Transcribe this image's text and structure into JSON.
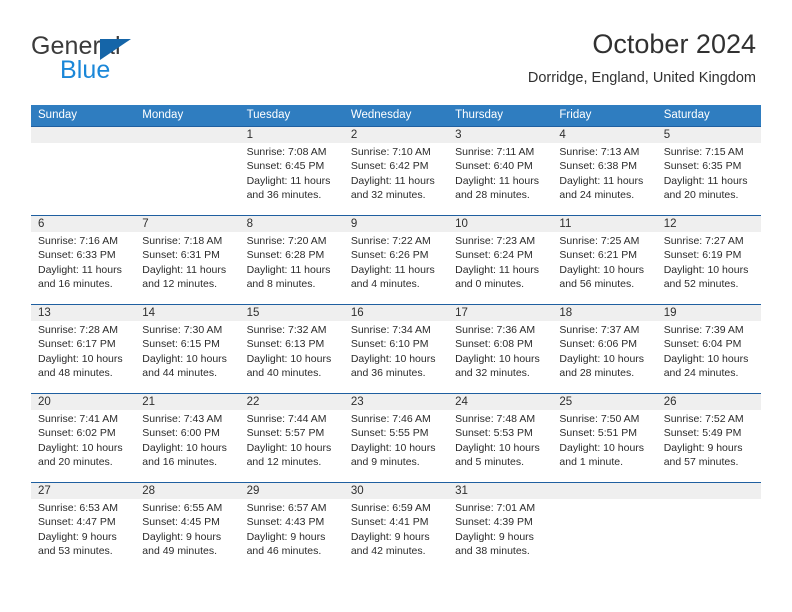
{
  "brand": {
    "line1": "General",
    "line2": "Blue",
    "triangle_color": "#1565a8",
    "line2_color": "#1a87d8"
  },
  "header": {
    "title": "October 2024",
    "subtitle": "Dorridge, England, United Kingdom"
  },
  "theme": {
    "header_row_bg": "#2f7dc0",
    "week_rule": "#1f5fa0",
    "daynum_band": "#efefef"
  },
  "weekdays": [
    "Sunday",
    "Monday",
    "Tuesday",
    "Wednesday",
    "Thursday",
    "Friday",
    "Saturday"
  ],
  "weeks": [
    [
      {
        "day": "",
        "sunrise": "",
        "sunset": "",
        "daylight_l1": "",
        "daylight_l2": ""
      },
      {
        "day": "",
        "sunrise": "",
        "sunset": "",
        "daylight_l1": "",
        "daylight_l2": ""
      },
      {
        "day": "1",
        "sunrise": "Sunrise: 7:08 AM",
        "sunset": "Sunset: 6:45 PM",
        "daylight_l1": "Daylight: 11 hours",
        "daylight_l2": "and 36 minutes."
      },
      {
        "day": "2",
        "sunrise": "Sunrise: 7:10 AM",
        "sunset": "Sunset: 6:42 PM",
        "daylight_l1": "Daylight: 11 hours",
        "daylight_l2": "and 32 minutes."
      },
      {
        "day": "3",
        "sunrise": "Sunrise: 7:11 AM",
        "sunset": "Sunset: 6:40 PM",
        "daylight_l1": "Daylight: 11 hours",
        "daylight_l2": "and 28 minutes."
      },
      {
        "day": "4",
        "sunrise": "Sunrise: 7:13 AM",
        "sunset": "Sunset: 6:38 PM",
        "daylight_l1": "Daylight: 11 hours",
        "daylight_l2": "and 24 minutes."
      },
      {
        "day": "5",
        "sunrise": "Sunrise: 7:15 AM",
        "sunset": "Sunset: 6:35 PM",
        "daylight_l1": "Daylight: 11 hours",
        "daylight_l2": "and 20 minutes."
      }
    ],
    [
      {
        "day": "6",
        "sunrise": "Sunrise: 7:16 AM",
        "sunset": "Sunset: 6:33 PM",
        "daylight_l1": "Daylight: 11 hours",
        "daylight_l2": "and 16 minutes."
      },
      {
        "day": "7",
        "sunrise": "Sunrise: 7:18 AM",
        "sunset": "Sunset: 6:31 PM",
        "daylight_l1": "Daylight: 11 hours",
        "daylight_l2": "and 12 minutes."
      },
      {
        "day": "8",
        "sunrise": "Sunrise: 7:20 AM",
        "sunset": "Sunset: 6:28 PM",
        "daylight_l1": "Daylight: 11 hours",
        "daylight_l2": "and 8 minutes."
      },
      {
        "day": "9",
        "sunrise": "Sunrise: 7:22 AM",
        "sunset": "Sunset: 6:26 PM",
        "daylight_l1": "Daylight: 11 hours",
        "daylight_l2": "and 4 minutes."
      },
      {
        "day": "10",
        "sunrise": "Sunrise: 7:23 AM",
        "sunset": "Sunset: 6:24 PM",
        "daylight_l1": "Daylight: 11 hours",
        "daylight_l2": "and 0 minutes."
      },
      {
        "day": "11",
        "sunrise": "Sunrise: 7:25 AM",
        "sunset": "Sunset: 6:21 PM",
        "daylight_l1": "Daylight: 10 hours",
        "daylight_l2": "and 56 minutes."
      },
      {
        "day": "12",
        "sunrise": "Sunrise: 7:27 AM",
        "sunset": "Sunset: 6:19 PM",
        "daylight_l1": "Daylight: 10 hours",
        "daylight_l2": "and 52 minutes."
      }
    ],
    [
      {
        "day": "13",
        "sunrise": "Sunrise: 7:28 AM",
        "sunset": "Sunset: 6:17 PM",
        "daylight_l1": "Daylight: 10 hours",
        "daylight_l2": "and 48 minutes."
      },
      {
        "day": "14",
        "sunrise": "Sunrise: 7:30 AM",
        "sunset": "Sunset: 6:15 PM",
        "daylight_l1": "Daylight: 10 hours",
        "daylight_l2": "and 44 minutes."
      },
      {
        "day": "15",
        "sunrise": "Sunrise: 7:32 AM",
        "sunset": "Sunset: 6:13 PM",
        "daylight_l1": "Daylight: 10 hours",
        "daylight_l2": "and 40 minutes."
      },
      {
        "day": "16",
        "sunrise": "Sunrise: 7:34 AM",
        "sunset": "Sunset: 6:10 PM",
        "daylight_l1": "Daylight: 10 hours",
        "daylight_l2": "and 36 minutes."
      },
      {
        "day": "17",
        "sunrise": "Sunrise: 7:36 AM",
        "sunset": "Sunset: 6:08 PM",
        "daylight_l1": "Daylight: 10 hours",
        "daylight_l2": "and 32 minutes."
      },
      {
        "day": "18",
        "sunrise": "Sunrise: 7:37 AM",
        "sunset": "Sunset: 6:06 PM",
        "daylight_l1": "Daylight: 10 hours",
        "daylight_l2": "and 28 minutes."
      },
      {
        "day": "19",
        "sunrise": "Sunrise: 7:39 AM",
        "sunset": "Sunset: 6:04 PM",
        "daylight_l1": "Daylight: 10 hours",
        "daylight_l2": "and 24 minutes."
      }
    ],
    [
      {
        "day": "20",
        "sunrise": "Sunrise: 7:41 AM",
        "sunset": "Sunset: 6:02 PM",
        "daylight_l1": "Daylight: 10 hours",
        "daylight_l2": "and 20 minutes."
      },
      {
        "day": "21",
        "sunrise": "Sunrise: 7:43 AM",
        "sunset": "Sunset: 6:00 PM",
        "daylight_l1": "Daylight: 10 hours",
        "daylight_l2": "and 16 minutes."
      },
      {
        "day": "22",
        "sunrise": "Sunrise: 7:44 AM",
        "sunset": "Sunset: 5:57 PM",
        "daylight_l1": "Daylight: 10 hours",
        "daylight_l2": "and 12 minutes."
      },
      {
        "day": "23",
        "sunrise": "Sunrise: 7:46 AM",
        "sunset": "Sunset: 5:55 PM",
        "daylight_l1": "Daylight: 10 hours",
        "daylight_l2": "and 9 minutes."
      },
      {
        "day": "24",
        "sunrise": "Sunrise: 7:48 AM",
        "sunset": "Sunset: 5:53 PM",
        "daylight_l1": "Daylight: 10 hours",
        "daylight_l2": "and 5 minutes."
      },
      {
        "day": "25",
        "sunrise": "Sunrise: 7:50 AM",
        "sunset": "Sunset: 5:51 PM",
        "daylight_l1": "Daylight: 10 hours",
        "daylight_l2": "and 1 minute."
      },
      {
        "day": "26",
        "sunrise": "Sunrise: 7:52 AM",
        "sunset": "Sunset: 5:49 PM",
        "daylight_l1": "Daylight: 9 hours",
        "daylight_l2": "and 57 minutes."
      }
    ],
    [
      {
        "day": "27",
        "sunrise": "Sunrise: 6:53 AM",
        "sunset": "Sunset: 4:47 PM",
        "daylight_l1": "Daylight: 9 hours",
        "daylight_l2": "and 53 minutes."
      },
      {
        "day": "28",
        "sunrise": "Sunrise: 6:55 AM",
        "sunset": "Sunset: 4:45 PM",
        "daylight_l1": "Daylight: 9 hours",
        "daylight_l2": "and 49 minutes."
      },
      {
        "day": "29",
        "sunrise": "Sunrise: 6:57 AM",
        "sunset": "Sunset: 4:43 PM",
        "daylight_l1": "Daylight: 9 hours",
        "daylight_l2": "and 46 minutes."
      },
      {
        "day": "30",
        "sunrise": "Sunrise: 6:59 AM",
        "sunset": "Sunset: 4:41 PM",
        "daylight_l1": "Daylight: 9 hours",
        "daylight_l2": "and 42 minutes."
      },
      {
        "day": "31",
        "sunrise": "Sunrise: 7:01 AM",
        "sunset": "Sunset: 4:39 PM",
        "daylight_l1": "Daylight: 9 hours",
        "daylight_l2": "and 38 minutes."
      },
      {
        "day": "",
        "sunrise": "",
        "sunset": "",
        "daylight_l1": "",
        "daylight_l2": ""
      },
      {
        "day": "",
        "sunrise": "",
        "sunset": "",
        "daylight_l1": "",
        "daylight_l2": ""
      }
    ]
  ]
}
